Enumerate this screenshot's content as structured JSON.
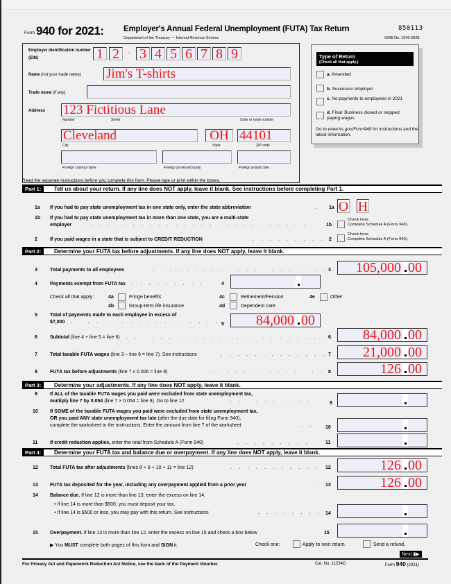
{
  "header": {
    "form_word": "Form",
    "form_number": "940 for 2021:",
    "title": "Employer's Annual Federal Unemployment (FUTA) Tax Return",
    "subtitle": "Department of the Treasury — Internal Revenue Service",
    "barcode": "850113",
    "omb": "OMB No. 1545-0028"
  },
  "employer": {
    "ein_label": "Employer identification number",
    "ein_sublabel": "(EIN)",
    "ein_digits": [
      "1",
      "2",
      "3",
      "4",
      "5",
      "6",
      "7",
      "8",
      "9"
    ],
    "ein_dash": "-",
    "name_label": "Name",
    "name_hint": "(not your trade name)",
    "name_value": "Jim's T-shirts",
    "trade_label": "Trade name",
    "trade_hint": "(if any)",
    "trade_value": "",
    "address_label": "Address",
    "street_value": "123 Fictitious Lane",
    "number_caption": "Number",
    "street_caption": "Street",
    "suite_caption": "Suite or room number",
    "city_value": "Cleveland",
    "state_value": "OH",
    "zip_value": "44101",
    "city_caption": "City",
    "state_caption": "State",
    "zip_caption": "ZIP code",
    "foreign_country_caption": "Foreign country name",
    "foreign_province_caption": "Foreign province/county",
    "foreign_postal_caption": "Foreign postal code"
  },
  "type_of_return": {
    "title": "Type of Return",
    "subtitle": "(Check all that apply.)",
    "options": [
      {
        "letter": "a.",
        "label": "Amended",
        "checked": false
      },
      {
        "letter": "b.",
        "label": "Successor employer",
        "checked": false
      },
      {
        "letter": "c.",
        "label": "No payments to employees in 2021",
        "checked": false
      },
      {
        "letter": "d.",
        "label": "Final: Business closed or stopped paying wages",
        "checked": false
      }
    ],
    "footer_pre": "Go to ",
    "footer_link": "www.irs.gov/Form940",
    "footer_post": " for instructions and the latest information."
  },
  "instructions_note": "Read the separate instructions before you complete this form. Please type or print within the boxes.",
  "part1": {
    "label": "Part 1:",
    "title": "Tell us about your return. If any line does NOT apply, leave it blank. See instructions before completing Part 1.",
    "line1a": {
      "num": "1a",
      "text": "If you had to pay state unemployment tax in one state only, enter the state abbreviation",
      "box_num": "1a",
      "state_letters": [
        "O",
        "H"
      ]
    },
    "line1b": {
      "num": "1b",
      "text1": "If you had to pay state unemployment tax in more than one state, you are a multi-state",
      "text2": "employer",
      "box_num": "1b",
      "check_line1": "Check here.",
      "check_line2": "Complete Schedule A (Form 940).",
      "checked": false
    },
    "line2": {
      "num": "2",
      "text": "If you paid wages in a state that is subject to CREDIT REDUCTION",
      "box_num": "2",
      "check_line1": "Check here.",
      "check_line2": "Complete Schedule A (Form 940).",
      "checked": false
    }
  },
  "part2": {
    "label": "Part 2:",
    "title": "Determine your FUTA tax before adjustments. If any line does NOT apply, leave it blank.",
    "line3": {
      "num": "3",
      "text": "Total payments to all employees",
      "box_num": "3",
      "dollars": "105,000",
      "cents": "00"
    },
    "line4": {
      "num": "4",
      "text": "Payments exempt from FUTA tax",
      "box_num": "4",
      "dollars": "",
      "cents": ""
    },
    "check_all": "Check all that apply:",
    "checks": [
      {
        "code": "4a",
        "label": "Fringe benefits",
        "checked": false
      },
      {
        "code": "4b",
        "label": "Group-term life insurance",
        "checked": false
      },
      {
        "code": "4c",
        "label": "Retirement/Pension",
        "checked": false
      },
      {
        "code": "4d",
        "label": "Dependent care",
        "checked": false
      },
      {
        "code": "4e",
        "label": "Other",
        "checked": false
      }
    ],
    "line5": {
      "num": "5",
      "text1": "Total of payments made to each employee in excess of",
      "text2": "$7,000",
      "box_num": "5",
      "dollars": "84,000",
      "cents": "00"
    },
    "line6": {
      "num": "6",
      "bold": "Subtotal",
      "text": " (line 4 + line 5 = line 6)",
      "box_num": "6",
      "dollars": "84,000",
      "cents": "00"
    },
    "line7": {
      "num": "7",
      "bold": "Total taxable FUTA wages",
      "text": " (line 3 – line 6 = line 7). See instructions",
      "box_num": "7",
      "dollars": "21,000",
      "cents": "00"
    },
    "line8": {
      "num": "8",
      "bold": "FUTA tax before adjustments",
      "text": " (line 7 x 0.006 = line 8)",
      "box_num": "8",
      "dollars": "126",
      "cents": "00"
    }
  },
  "part3": {
    "label": "Part 3:",
    "title": "Determine your adjustments. If any line does NOT apply, leave it blank.",
    "line9": {
      "num": "9",
      "text1": "If ALL of the taxable FUTA wages you paid were excluded from state unemployment tax,",
      "bold2": "multiply line 7 by 0.054",
      "text2": " (line 7 × 0.054 = line 9). Go to line 12",
      "box_num": "9",
      "dollars": "",
      "cents": ""
    },
    "line10": {
      "num": "10",
      "text1": "If SOME of the taxable FUTA wages you paid were excluded from state unemployment tax,",
      "bold2": "OR you paid ANY state unemployment tax late",
      "text2": " (after the due date for filing Form 940),",
      "text3": "complete the worksheet in the instructions. Enter the amount from line 7 of the worksheet",
      "box_num": "10",
      "dollars": "",
      "cents": ""
    },
    "line11": {
      "num": "11",
      "bold": "If credit reduction applies,",
      "text": " enter the total from Schedule A (Form 940)",
      "box_num": "11",
      "dollars": "",
      "cents": ""
    }
  },
  "part4": {
    "label": "Part 4:",
    "title": "Determine your FUTA tax and balance due or overpayment. If any line does NOT apply, leave it blank.",
    "line12": {
      "num": "12",
      "bold": "Total FUTA tax after adjustments",
      "text": " (lines 8 + 9 + 10 + 11 = line 12)",
      "box_num": "12",
      "dollars": "126",
      "cents": "00"
    },
    "line13": {
      "num": "13",
      "bold": "FUTA tax deposited for the year, including any overpayment applied from a prior year",
      "box_num": "13",
      "dollars": "126",
      "cents": "00"
    },
    "line14": {
      "num": "14",
      "bold": "Balance due.",
      "text": " If line 12 is more than line 13, enter the excess on line 14.",
      "bullet1": "If line 14 is more than $500, you must deposit your tax.",
      "bullet2": "If line 14 is $500 or less, you may pay with this return. See instructions",
      "box_num": "14",
      "dollars": "",
      "cents": ""
    },
    "line15": {
      "num": "15",
      "bold": "Overpayment.",
      "text": " If line 13 is more than line 12, enter the excess on line 15 and check a box below",
      "box_num": "15",
      "dollars": "",
      "cents": ""
    },
    "must_pre": "▶ You ",
    "must_bold1": "MUST",
    "must_mid": " complete both pages of this form and ",
    "must_bold2": "SIGN",
    "must_post": " it.",
    "check_one": "Check one:",
    "apply_label": "Apply to next return.",
    "refund_label": "Send a refund."
  },
  "next_button": "Next",
  "footer": {
    "privacy": "For Privacy Act and Paperwork Reduction Act Notice, see the back of the Payment Voucher.",
    "cat": "Cat. No. 11234O",
    "form_word": "Form",
    "form_num": "940",
    "year": "(2021)"
  },
  "colors": {
    "entry_text": "#ee1111",
    "field_bg": "#eeeef8",
    "page_bg": "#f0f0f0"
  }
}
